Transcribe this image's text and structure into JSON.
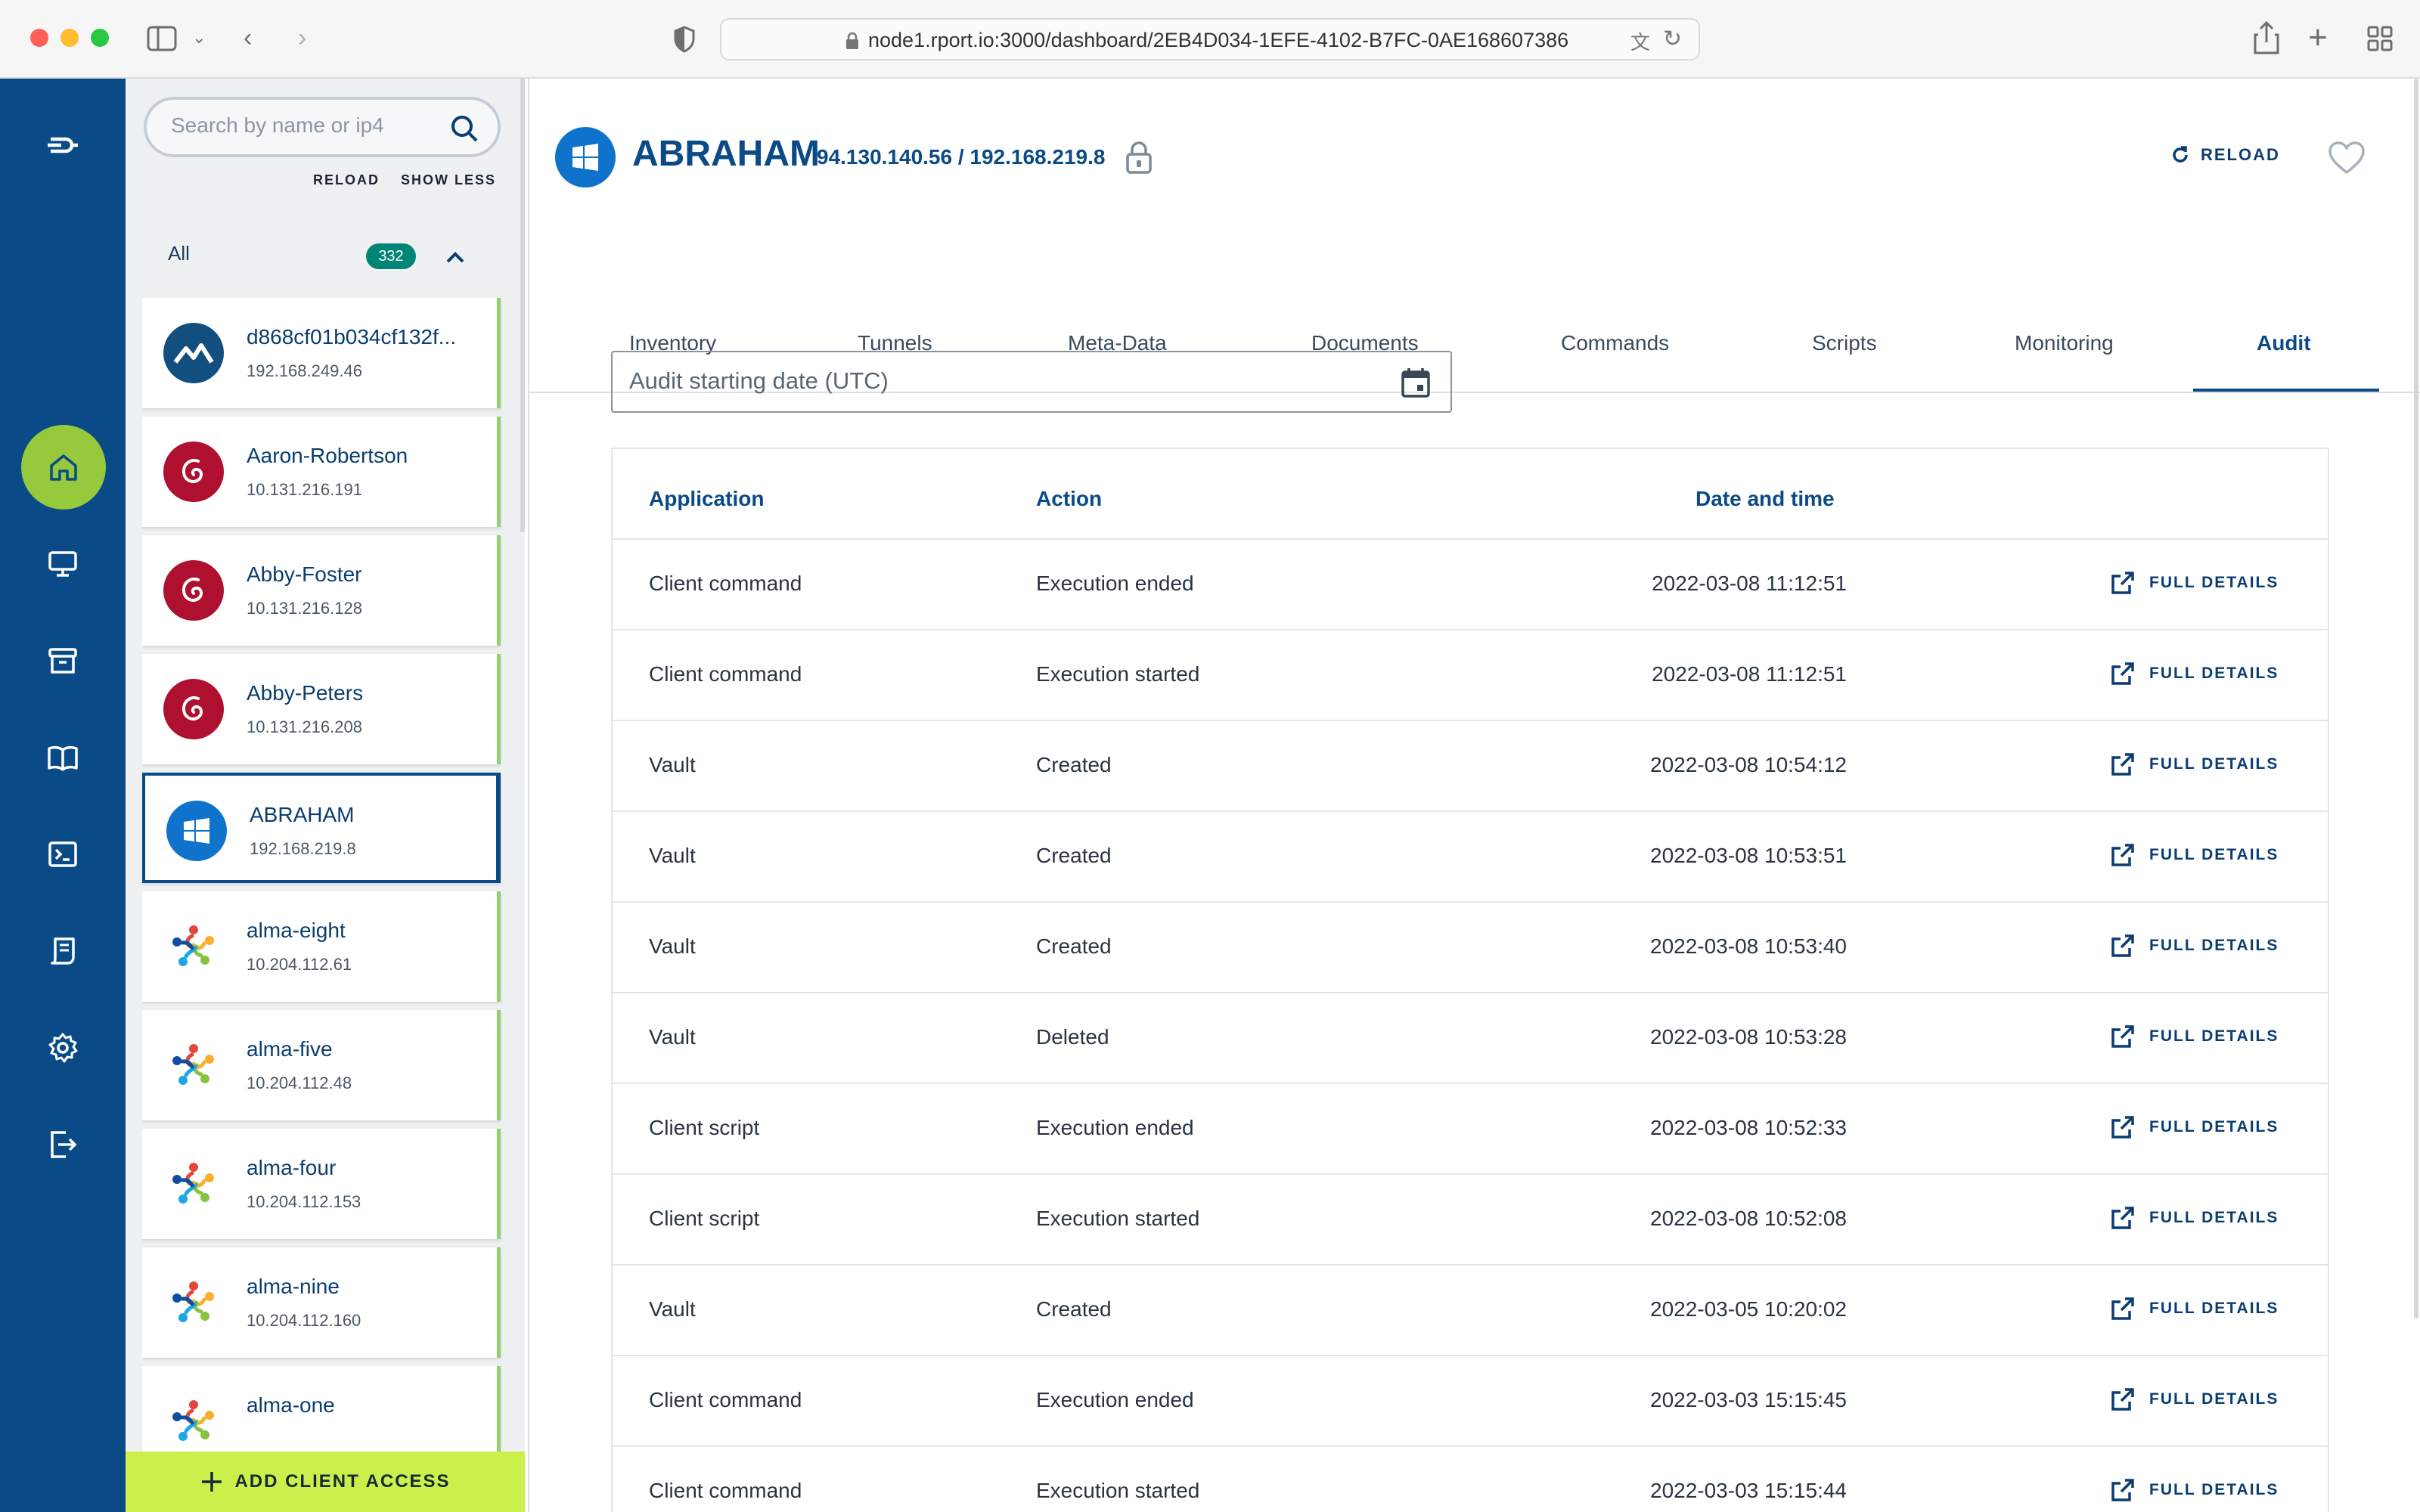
{
  "browser": {
    "url": "node1.rport.io:3000/dashboard/2EB4D034-1EFE-4102-B7FC-0AE168607386"
  },
  "sidebar": {
    "search_placeholder": "Search by name or ip4",
    "reload_label": "RELOAD",
    "show_less_label": "SHOW LESS",
    "filter_label": "All",
    "client_count": "332",
    "clients": [
      {
        "name": "d868cf01b034cf132f...",
        "ip": "192.168.249.46",
        "os": "mountain-icon"
      },
      {
        "name": "Aaron-Robertson",
        "ip": "10.131.216.191",
        "os": "debian-icon"
      },
      {
        "name": "Abby-Foster",
        "ip": "10.131.216.128",
        "os": "debian-icon"
      },
      {
        "name": "Abby-Peters",
        "ip": "10.131.216.208",
        "os": "debian-icon"
      },
      {
        "name": "ABRAHAM",
        "ip": "192.168.219.8",
        "os": "windows-icon"
      },
      {
        "name": "alma-eight",
        "ip": "10.204.112.61",
        "os": "almalinux-icon"
      },
      {
        "name": "alma-five",
        "ip": "10.204.112.48",
        "os": "almalinux-icon"
      },
      {
        "name": "alma-four",
        "ip": "10.204.112.153",
        "os": "almalinux-icon"
      },
      {
        "name": "alma-nine",
        "ip": "10.204.112.160",
        "os": "almalinux-icon"
      },
      {
        "name": "alma-one",
        "ip": "",
        "os": "almalinux-icon"
      }
    ],
    "add_client_label": "ADD CLIENT ACCESS"
  },
  "header": {
    "hostname": "ABRAHAM",
    "ips": "94.130.140.56 / 192.168.219.8",
    "reload_label": "RELOAD"
  },
  "tabs": [
    "Inventory",
    "Tunnels",
    "Meta-Data",
    "Documents",
    "Commands",
    "Scripts",
    "Monitoring",
    "Audit"
  ],
  "active_tab": "Audit",
  "audit": {
    "date_placeholder": "Audit starting date (UTC)",
    "columns": [
      "Application",
      "Action",
      "Date and time"
    ],
    "details_label": "FULL DETAILS",
    "rows": [
      {
        "application": "Client command",
        "action": "Execution ended",
        "datetime": "2022-03-08 11:12:51"
      },
      {
        "application": "Client command",
        "action": "Execution started",
        "datetime": "2022-03-08 11:12:51"
      },
      {
        "application": "Vault",
        "action": "Created",
        "datetime": "2022-03-08 10:54:12"
      },
      {
        "application": "Vault",
        "action": "Created",
        "datetime": "2022-03-08 10:53:51"
      },
      {
        "application": "Vault",
        "action": "Created",
        "datetime": "2022-03-08 10:53:40"
      },
      {
        "application": "Vault",
        "action": "Deleted",
        "datetime": "2022-03-08 10:53:28"
      },
      {
        "application": "Client script",
        "action": "Execution ended",
        "datetime": "2022-03-08 10:52:33"
      },
      {
        "application": "Client script",
        "action": "Execution started",
        "datetime": "2022-03-08 10:52:08"
      },
      {
        "application": "Vault",
        "action": "Created",
        "datetime": "2022-03-05 10:20:02"
      },
      {
        "application": "Client command",
        "action": "Execution ended",
        "datetime": "2022-03-03 15:15:45"
      },
      {
        "application": "Client command",
        "action": "Execution started",
        "datetime": "2022-03-03 15:15:44"
      }
    ]
  },
  "colors": {
    "brand_blue": "#0a4a87",
    "accent_green": "#97c93d",
    "add_button": "#cbf04c",
    "badge_teal": "#008577"
  }
}
